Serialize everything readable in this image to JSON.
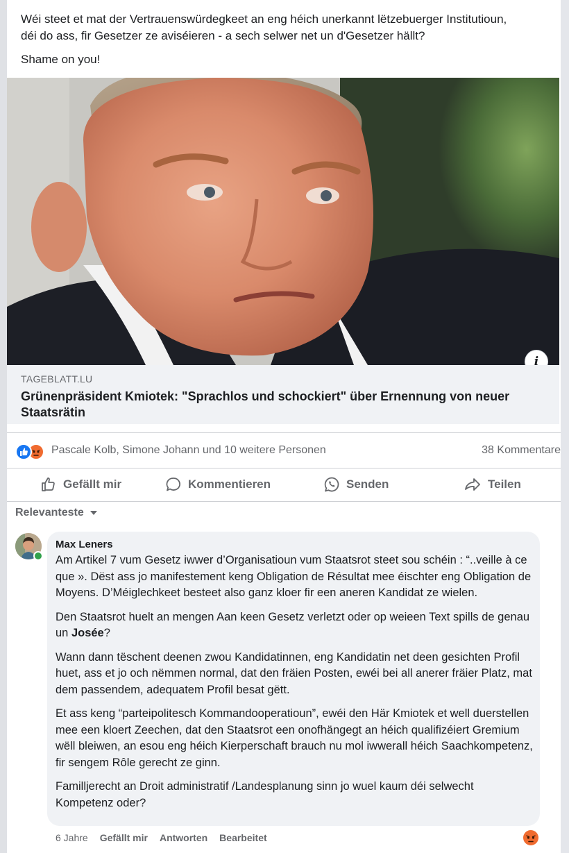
{
  "post": {
    "text_line1": "Wéi steet et mat der Vertrauenswürdegkeet an eng héich unerkannt lëtzebuerger Institutioun,",
    "text_line2": "déi do ass, fir Gesetzer ze aviséieren -  a sech selwer net un d'Gesetzer hällt?",
    "text_line3": "Shame on you!"
  },
  "link_card": {
    "domain": "TAGEBLATT.LU",
    "title": "Grünenpräsident Kmiotek: \"Sprachlos und schockiert\" über Ernennung von neuer Staatsrätin",
    "info_glyph": "i"
  },
  "reactions": {
    "icons": [
      "like-icon",
      "angry-icon"
    ],
    "reactors": "Pascale Kolb, Simone Johann und 10 weitere Personen",
    "comments_count": "38 Kommentare"
  },
  "actions": {
    "like": "Gefällt mir",
    "comment": "Kommentieren",
    "send": "Senden",
    "share": "Teilen"
  },
  "sort": {
    "label": "Relevanteste"
  },
  "comment": {
    "author": "Max Leners",
    "p1": "Am Artikel 7 vum Gesetz iwwer d’Organisatioun vum Staatsrot steet sou schéin : “..veille à ce que ». Dëst ass jo manifestement keng Obligation de Résultat mee éischter eng Obligation de Moyens. D’Méiglechkeet besteet also ganz kloer fir een aneren Kandidat ze wielen.",
    "p2_before": "Den Staatsrot huelt an mengen Aan keen Gesetz verletzt oder op weieen Text spills de genau un ",
    "p2_mention": "Josée",
    "p2_after": "?",
    "p3": "Wann dann tëschent deenen zwou Kandidatinnen, eng Kandidatin net deen gesichten Profil huet, ass et jo och nëmmen normal, dat den fräien Posten, ewéi bei all anerer fräier Platz, mat dem passendem, adequatem Profil besat gëtt.",
    "p4": "Et ass keng “parteipolitesch Kommandooperatioun”, ewéi den Här Kmiotek et well duerstellen mee een kloert Zeechen, dat den Staatsrot een onofhängegt an héich qualifizéiert Gremium wëll bleiwen, an esou eng héich Kierperschaft brauch nu mol iwwerall héich Saachkompetenz, fir sengem Rôle gerecht ze ginn.",
    "p5": "Familljerecht an Droit administratif /Landesplanung sinn jo wuel kaum déi selwecht Kompetenz oder?",
    "time": "6 Jahre",
    "like": "Gefällt mir",
    "reply": "Antworten",
    "edited": "Bearbeitet",
    "reaction_icon": "angry-icon"
  },
  "colors": {
    "accent_blue": "#1877f2",
    "angry_orange": "#f06b2f",
    "meta_gray": "#65676b",
    "bubble_bg": "#f0f2f5",
    "online_green": "#31a24c"
  }
}
